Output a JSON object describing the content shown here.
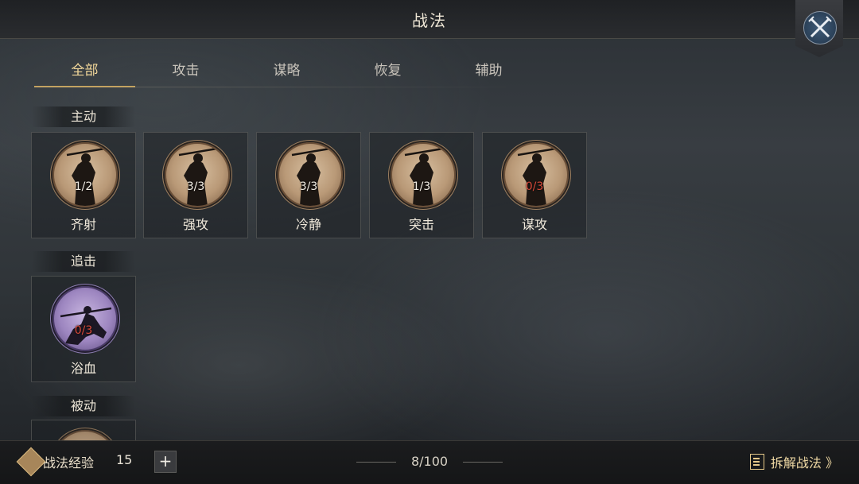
{
  "header": {
    "title": "战法"
  },
  "tabs": [
    {
      "label": "全部",
      "active": true
    },
    {
      "label": "攻击",
      "active": false
    },
    {
      "label": "谋略",
      "active": false
    },
    {
      "label": "恢复",
      "active": false
    },
    {
      "label": "辅助",
      "active": false
    }
  ],
  "sections": {
    "active": {
      "label": "主动"
    },
    "pursuit": {
      "label": "追击"
    },
    "passive": {
      "label": "被动"
    }
  },
  "active_skills": [
    {
      "name": "齐射",
      "count": "1/2",
      "icon": "spear-warrior-icon"
    },
    {
      "name": "强攻",
      "count": "3/3",
      "icon": "spear-warrior-icon"
    },
    {
      "name": "冷静",
      "count": "3/3",
      "icon": "spear-warrior-icon"
    },
    {
      "name": "突击",
      "count": "1/3",
      "icon": "spear-warrior-icon"
    },
    {
      "name": "谋攻",
      "count": "0/3",
      "icon": "spear-warrior-icon"
    }
  ],
  "pursuit_skills": [
    {
      "name": "浴血",
      "count": "0/3",
      "icon": "cavalry-charge-icon"
    }
  ],
  "footer": {
    "exp_label": "战法经验",
    "exp_value": "15",
    "plus_label": "+",
    "page_count": "8/100",
    "disassemble_label": "拆解战法 》"
  },
  "colors": {
    "accent_gold": "#c8a45c",
    "count_zero": "#d84a3a",
    "medal_bronze": "#b99977",
    "medal_purple": "#9d86c0"
  }
}
